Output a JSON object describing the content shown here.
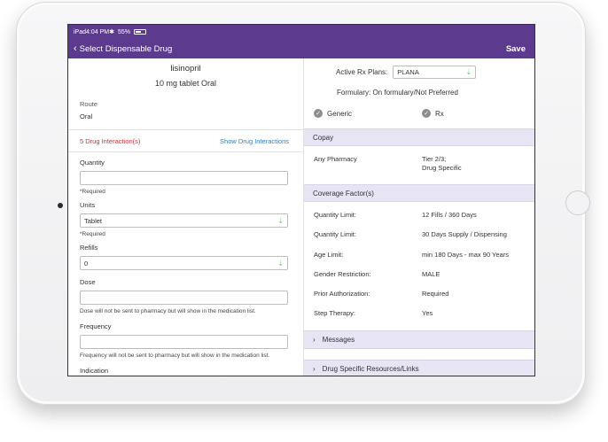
{
  "status_bar": {
    "carrier": "iPad",
    "time": "4:04 PM",
    "battery": "55%"
  },
  "nav": {
    "back_label": "Select Dispensable Drug",
    "save_label": "Save"
  },
  "drug": {
    "name": "lisinopril",
    "form": "10 mg tablet Oral"
  },
  "route": {
    "label": "Route",
    "value": "Oral"
  },
  "interactions": {
    "count_label": "5 Drug Interaction(s)",
    "link_label": "Show Drug Interactions"
  },
  "form": {
    "quantity": {
      "label": "Quantity",
      "value": "",
      "hint": "*Required"
    },
    "units": {
      "label": "Units",
      "value": "Tablet",
      "hint": "*Required"
    },
    "refills": {
      "label": "Refills",
      "value": "0"
    },
    "dose": {
      "label": "Dose",
      "value": "",
      "hint": "Dose will not be sent to pharmacy but will show in the medication list."
    },
    "frequency": {
      "label": "Frequency",
      "value": "",
      "hint": "Frequency will not be sent to pharmacy but will show in the medication list."
    },
    "indication": {
      "label": "Indication",
      "value": ""
    }
  },
  "plans": {
    "label": "Active Rx Plans:",
    "selected": "PLANA"
  },
  "formulary": "Formulary: On formulary/Not Preferred",
  "checks": [
    {
      "label": "Generic",
      "icon": "check-circle-icon"
    },
    {
      "label": "Rx",
      "icon": "check-circle-icon"
    }
  ],
  "copay": {
    "title": "Copay",
    "rows": [
      {
        "key": "Any Pharmacy",
        "value_line1": "Tier 2/3;",
        "value_line2": "Drug Specific"
      }
    ]
  },
  "coverage": {
    "title": "Coverage Factor(s)",
    "rows": [
      {
        "key": "Quantity Limit:",
        "value": "12 Fills / 360 Days"
      },
      {
        "key": "Quantity Limit:",
        "value": "30 Days Supply /  Dispensing"
      },
      {
        "key": "Age Limit:",
        "value": "min 180 Days - max 90 Years"
      },
      {
        "key": "Gender Restriction:",
        "value": "MALE"
      },
      {
        "key": "Prior Authorization:",
        "value": "Required"
      },
      {
        "key": "Step Therapy:",
        "value": "Yes"
      }
    ]
  },
  "expandables": [
    {
      "label": "Messages"
    },
    {
      "label": "Drug Specific Resources/Links"
    }
  ],
  "colors": {
    "nav": "#5c3b8e",
    "section": "#e7e4f4",
    "alert": "#c9343b",
    "link": "#2f7ec9",
    "chevron": "#7ac47e"
  }
}
